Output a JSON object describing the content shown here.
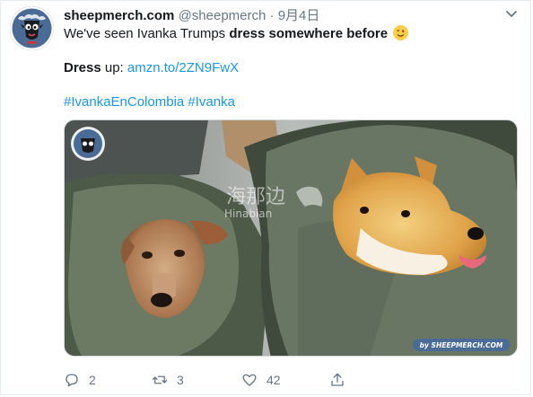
{
  "tweet": {
    "display_name": "sheepmerch.com",
    "handle": "@sheepmerch",
    "separator": "·",
    "date": "9月4日",
    "line1_prefix": "We've seen Ivanka Trumps ",
    "line1_bold": "dress somewhere before",
    "line2_bold": "Dress",
    "line2_mid": " up: ",
    "line2_link": "amzn.to/2ZN9FwX",
    "hashtag1": "#IvankaEnColombia",
    "hashtag2": "#Ivanka",
    "emoji_name": "winking-face-emoji"
  },
  "media": {
    "watermark_cn": "海那边",
    "watermark_en": "Hinabian",
    "badge_text": "by SHEEPMERCH.COM"
  },
  "actions": {
    "reply_count": "2",
    "retweet_count": "3",
    "like_count": "42"
  },
  "colors": {
    "link": "#1b95e0",
    "secondary_text": "#657786",
    "primary_text": "#14171a"
  }
}
